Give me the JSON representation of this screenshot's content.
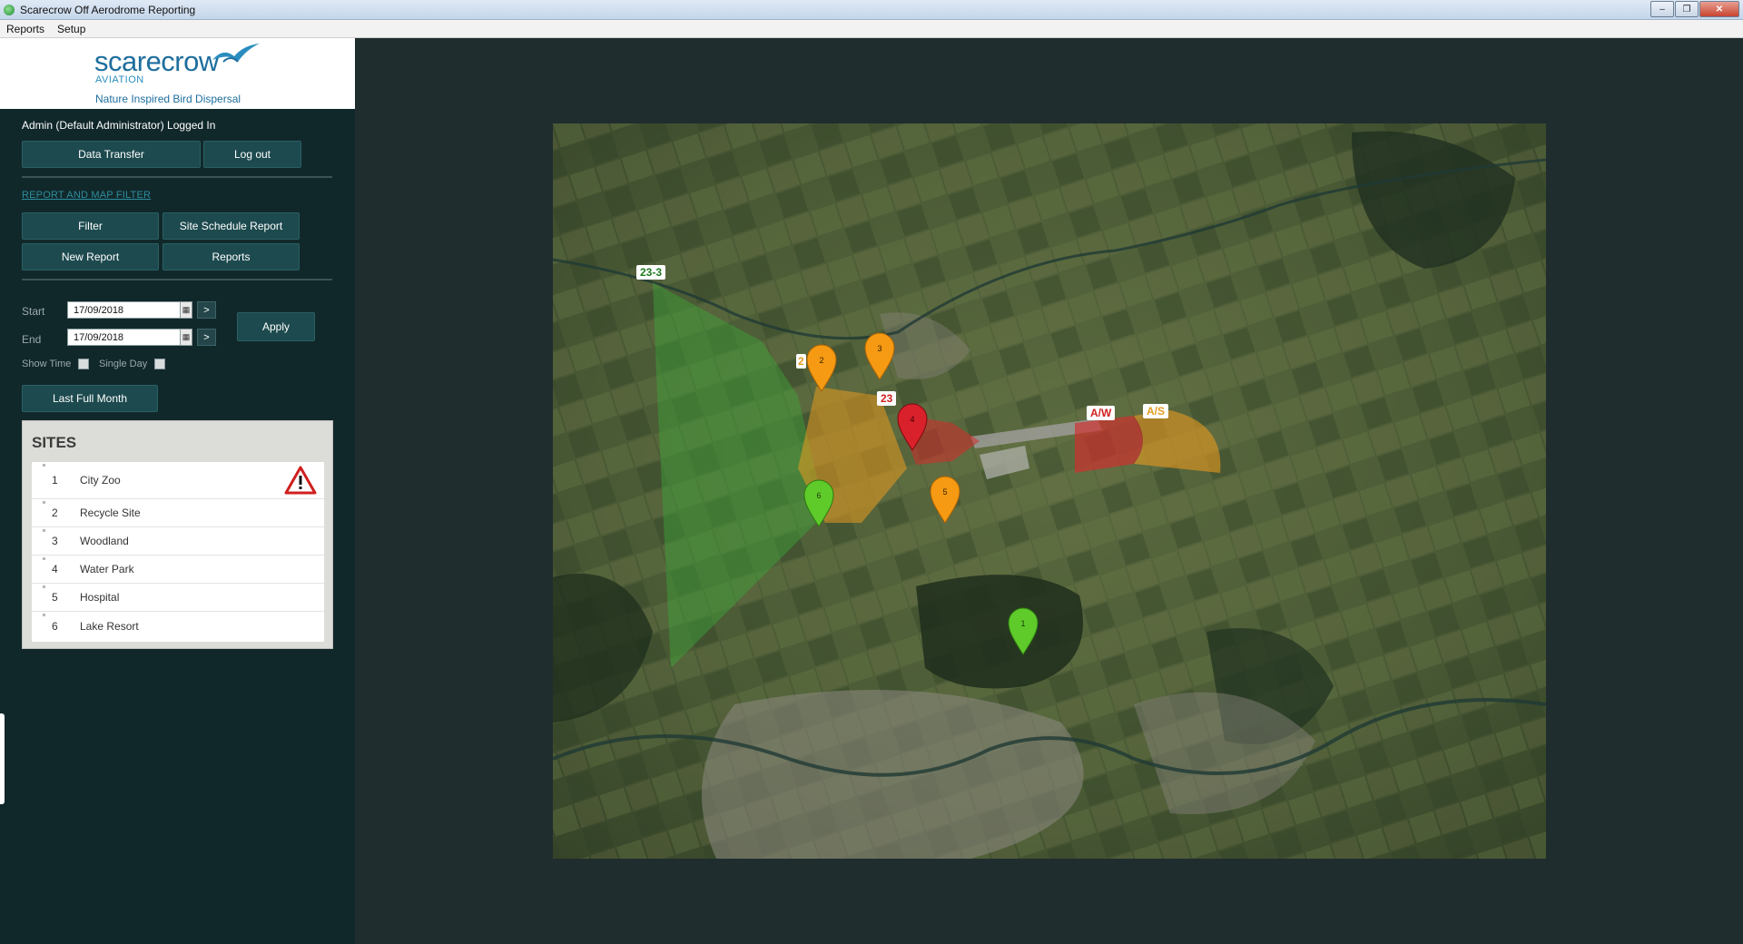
{
  "window": {
    "title": "Scarecrow Off Aerodrome Reporting",
    "minimize": "‒",
    "maximize": "❐",
    "close": "✕"
  },
  "menu": {
    "items": [
      "Reports",
      "Setup"
    ]
  },
  "logo": {
    "brand": "scarecrow",
    "sub": "AVIATION",
    "tagline": "Nature Inspired Bird Dispersal"
  },
  "user": {
    "status": "Admin (Default Administrator) Logged In"
  },
  "buttons": {
    "data_transfer": "Data Transfer",
    "log_out": "Log out",
    "filter": "Filter",
    "site_schedule_report": "Site Schedule Report",
    "new_report": "New Report",
    "reports": "Reports",
    "apply": "Apply",
    "last_full_month": "Last Full Month",
    "next": ">"
  },
  "filter": {
    "link": "REPORT AND MAP FILTER",
    "start_label": "Start",
    "end_label": "End",
    "start_value": "17/09/2018",
    "end_value": "17/09/2018",
    "show_time_label": "Show Time",
    "single_day_label": "Single Day",
    "show_time_checked": false,
    "single_day_checked": false
  },
  "sites": {
    "title": "SITES",
    "rows": [
      {
        "num": "1",
        "name": "City Zoo",
        "warning": true
      },
      {
        "num": "2",
        "name": "Recycle Site",
        "warning": false
      },
      {
        "num": "3",
        "name": "Woodland",
        "warning": false
      },
      {
        "num": "4",
        "name": "Water Park",
        "warning": false
      },
      {
        "num": "5",
        "name": "Hospital",
        "warning": false
      },
      {
        "num": "6",
        "name": "Lake Resort",
        "warning": false
      }
    ]
  },
  "map": {
    "labels": {
      "zone_23_3": "23-3",
      "zone_23": "23",
      "zone_2": "2",
      "zone_aw": "A/W",
      "zone_as": "A/S"
    },
    "markers": [
      {
        "num": "1",
        "status": "green"
      },
      {
        "num": "2",
        "status": "orange"
      },
      {
        "num": "3",
        "status": "orange"
      },
      {
        "num": "4",
        "status": "red"
      },
      {
        "num": "5",
        "status": "orange"
      },
      {
        "num": "6",
        "status": "green"
      }
    ],
    "colors": {
      "green": "#5fcb2a",
      "orange": "#f59a12",
      "red": "#d8212a",
      "zone_green": "#3da63a",
      "zone_orange": "#e79a1f",
      "zone_red": "#d52c2c"
    }
  }
}
